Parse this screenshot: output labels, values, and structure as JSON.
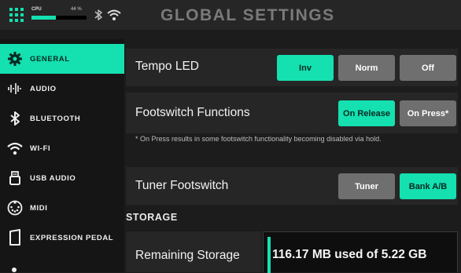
{
  "header": {
    "title": "GLOBAL SETTINGS",
    "cpu_label": "CPU",
    "cpu_percent_text": "44 %",
    "cpu_load_fraction": 0.44
  },
  "sidebar": {
    "items": [
      {
        "label": "GENERAL",
        "icon": "gear-icon",
        "active": true
      },
      {
        "label": "AUDIO",
        "icon": "waveform-icon",
        "active": false
      },
      {
        "label": "BLUETOOTH",
        "icon": "bluetooth-icon",
        "active": false
      },
      {
        "label": "WI-FI",
        "icon": "wifi-icon",
        "active": false
      },
      {
        "label": "USB AUDIO",
        "icon": "usb-icon",
        "active": false
      },
      {
        "label": "MIDI",
        "icon": "midi-icon",
        "active": false
      },
      {
        "label": "EXPRESSION PEDAL",
        "icon": "pedal-icon",
        "active": false
      }
    ]
  },
  "settings": {
    "tempo_led": {
      "label": "Tempo LED",
      "options": [
        "Inv",
        "Norm",
        "Off"
      ],
      "selected": "Inv"
    },
    "footswitch_functions": {
      "label": "Footswitch Functions",
      "options": [
        "On Release",
        "On Press*"
      ],
      "selected": "On Release",
      "note": "* On Press results in some footswitch functionality becoming disabled via hold."
    },
    "tuner_footswitch": {
      "label": "Tuner Footswitch",
      "options": [
        "Tuner",
        "Bank A/B"
      ],
      "selected": "Bank A/B"
    }
  },
  "storage": {
    "heading": "STORAGE",
    "label": "Remaining Storage",
    "value": "116.17 MB used of 5.22 GB"
  },
  "colors": {
    "accent": "#14e0b0",
    "inactive_button": "#6f6f6f",
    "panel": "#262626",
    "background": "#1c1c1c"
  }
}
